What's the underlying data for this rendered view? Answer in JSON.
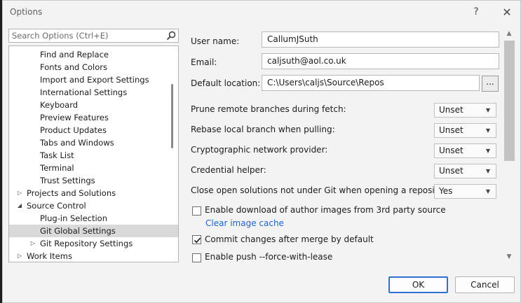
{
  "window": {
    "title": "Options",
    "help_glyph": "?",
    "close_glyph": "✕"
  },
  "search": {
    "placeholder": "Search Options (Ctrl+E)"
  },
  "tree": {
    "items": [
      {
        "label": "Find and Replace",
        "level": 2,
        "expander": "",
        "selected": false
      },
      {
        "label": "Fonts and Colors",
        "level": 2,
        "expander": "",
        "selected": false
      },
      {
        "label": "Import and Export Settings",
        "level": 2,
        "expander": "",
        "selected": false
      },
      {
        "label": "International Settings",
        "level": 2,
        "expander": "",
        "selected": false
      },
      {
        "label": "Keyboard",
        "level": 2,
        "expander": "",
        "selected": false
      },
      {
        "label": "Preview Features",
        "level": 2,
        "expander": "",
        "selected": false
      },
      {
        "label": "Product Updates",
        "level": 2,
        "expander": "",
        "selected": false
      },
      {
        "label": "Tabs and Windows",
        "level": 2,
        "expander": "",
        "selected": false
      },
      {
        "label": "Task List",
        "level": 2,
        "expander": "",
        "selected": false
      },
      {
        "label": "Terminal",
        "level": 2,
        "expander": "",
        "selected": false
      },
      {
        "label": "Trust Settings",
        "level": 2,
        "expander": "",
        "selected": false
      },
      {
        "label": "Projects and Solutions",
        "level": 1,
        "expander": "▷",
        "selected": false
      },
      {
        "label": "Source Control",
        "level": 1,
        "expander": "◢",
        "selected": false
      },
      {
        "label": "Plug-in Selection",
        "level": 2,
        "expander": "",
        "selected": false
      },
      {
        "label": "Git Global Settings",
        "level": 2,
        "expander": "",
        "selected": true
      },
      {
        "label": "Git Repository Settings",
        "level": 2,
        "expander": "▷",
        "selected": false
      },
      {
        "label": "Work Items",
        "level": 1,
        "expander": "▷",
        "selected": false
      }
    ]
  },
  "form": {
    "user_name": {
      "label": "User name:",
      "value": "CallumJSuth"
    },
    "email": {
      "label": "Email:",
      "value": "caljsuth@aol.co.uk"
    },
    "default_location": {
      "label": "Default location:",
      "value": "C:\\Users\\caljs\\Source\\Repos",
      "browse_label": "..."
    },
    "dropdowns": [
      {
        "label": "Prune remote branches during fetch:",
        "value": "Unset"
      },
      {
        "label": "Rebase local branch when pulling:",
        "value": "Unset"
      },
      {
        "label": "Cryptographic network provider:",
        "value": "Unset"
      },
      {
        "label": "Credential helper:",
        "value": "Unset"
      },
      {
        "label": "Close open solutions not under Git when opening a repository:",
        "value": "Yes"
      }
    ],
    "author_images": {
      "label": "Enable download of author images from 3rd party source",
      "checked": false
    },
    "clear_cache_link": "Clear image cache",
    "commit_after_merge": {
      "label": "Commit changes after merge by default",
      "checked": true
    },
    "force_with_lease": {
      "label": "Enable push --force-with-lease",
      "checked": false
    }
  },
  "buttons": {
    "ok": "OK",
    "cancel": "Cancel"
  },
  "colors": {
    "accent": "#2f6fd0",
    "link": "#1a65c9",
    "selection": "#d9d9d9"
  }
}
